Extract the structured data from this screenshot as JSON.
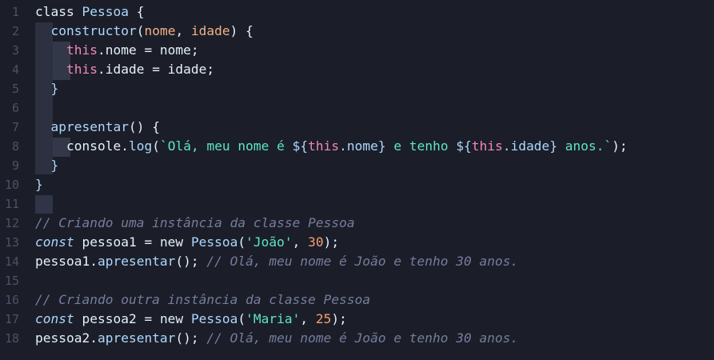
{
  "editor": {
    "line_numbers": [
      "1",
      "2",
      "3",
      "4",
      "5",
      "6",
      "7",
      "8",
      "9",
      "10",
      "11",
      "12",
      "13",
      "14",
      "15",
      "16",
      "17",
      "18"
    ],
    "lines": [
      [
        {
          "t": "class ",
          "c": "kw"
        },
        {
          "t": "Pessoa",
          "c": "cls"
        },
        {
          "t": " {",
          "c": "punct"
        }
      ],
      [
        {
          "t": "  ",
          "c": "punct"
        },
        {
          "t": "constructor",
          "c": "fn"
        },
        {
          "t": "(",
          "c": "punct"
        },
        {
          "t": "nome",
          "c": "param"
        },
        {
          "t": ", ",
          "c": "punct"
        },
        {
          "t": "idade",
          "c": "param"
        },
        {
          "t": ") {",
          "c": "punct"
        }
      ],
      [
        {
          "t": "    ",
          "c": "punct"
        },
        {
          "t": "this",
          "c": "this"
        },
        {
          "t": ".nome = nome;",
          "c": "prop"
        }
      ],
      [
        {
          "t": "    ",
          "c": "punct"
        },
        {
          "t": "this",
          "c": "this"
        },
        {
          "t": ".idade = idade;",
          "c": "prop"
        }
      ],
      [
        {
          "t": "  ",
          "c": "punct"
        },
        {
          "t": "}",
          "c": "brace"
        }
      ],
      [],
      [
        {
          "t": "  ",
          "c": "punct"
        },
        {
          "t": "apresentar",
          "c": "fn"
        },
        {
          "t": "() {",
          "c": "punct"
        }
      ],
      [
        {
          "t": "    ",
          "c": "punct"
        },
        {
          "t": "console",
          "c": "prop"
        },
        {
          "t": ".",
          "c": "punct"
        },
        {
          "t": "log",
          "c": "fn"
        },
        {
          "t": "(",
          "c": "punct"
        },
        {
          "t": "`Olá, meu nome é ",
          "c": "tpl"
        },
        {
          "t": "${",
          "c": "fn"
        },
        {
          "t": "this",
          "c": "this"
        },
        {
          "t": ".nome",
          "c": "fn"
        },
        {
          "t": "}",
          "c": "fn"
        },
        {
          "t": " e tenho ",
          "c": "tpl"
        },
        {
          "t": "${",
          "c": "fn"
        },
        {
          "t": "this",
          "c": "this"
        },
        {
          "t": ".idade",
          "c": "fn"
        },
        {
          "t": "}",
          "c": "fn"
        },
        {
          "t": " anos.`",
          "c": "tpl"
        },
        {
          "t": ");",
          "c": "punct"
        }
      ],
      [
        {
          "t": "  ",
          "c": "punct"
        },
        {
          "t": "}",
          "c": "brace"
        }
      ],
      [
        {
          "t": "}",
          "c": "brace"
        }
      ],
      [],
      [
        {
          "t": "// Criando uma instância da classe Pessoa",
          "c": "cmt"
        }
      ],
      [
        {
          "t": "const",
          "c": "ital"
        },
        {
          "t": " pessoa1 = ",
          "c": "prop"
        },
        {
          "t": "new",
          "c": "kw"
        },
        {
          "t": " ",
          "c": "punct"
        },
        {
          "t": "Pessoa",
          "c": "cls"
        },
        {
          "t": "(",
          "c": "punct"
        },
        {
          "t": "'João'",
          "c": "str"
        },
        {
          "t": ", ",
          "c": "punct"
        },
        {
          "t": "30",
          "c": "num"
        },
        {
          "t": ");",
          "c": "punct"
        }
      ],
      [
        {
          "t": "pessoa1.",
          "c": "prop"
        },
        {
          "t": "apresentar",
          "c": "fn"
        },
        {
          "t": "(); ",
          "c": "punct"
        },
        {
          "t": "// Olá, meu nome é João e tenho 30 anos.",
          "c": "cmt"
        }
      ],
      [],
      [
        {
          "t": "// Criando outra instância da classe Pessoa",
          "c": "cmt"
        }
      ],
      [
        {
          "t": "const",
          "c": "ital"
        },
        {
          "t": " pessoa2 = ",
          "c": "prop"
        },
        {
          "t": "new",
          "c": "kw"
        },
        {
          "t": " ",
          "c": "punct"
        },
        {
          "t": "Pessoa",
          "c": "cls"
        },
        {
          "t": "(",
          "c": "punct"
        },
        {
          "t": "'Maria'",
          "c": "str"
        },
        {
          "t": ", ",
          "c": "punct"
        },
        {
          "t": "25",
          "c": "num"
        },
        {
          "t": ");",
          "c": "punct"
        }
      ],
      [
        {
          "t": "pessoa2.",
          "c": "prop"
        },
        {
          "t": "apresentar",
          "c": "fn"
        },
        {
          "t": "(); ",
          "c": "punct"
        },
        {
          "t": "// Olá, meu nome é João e tenho 30 anos.",
          "c": "cmt"
        }
      ]
    ]
  }
}
